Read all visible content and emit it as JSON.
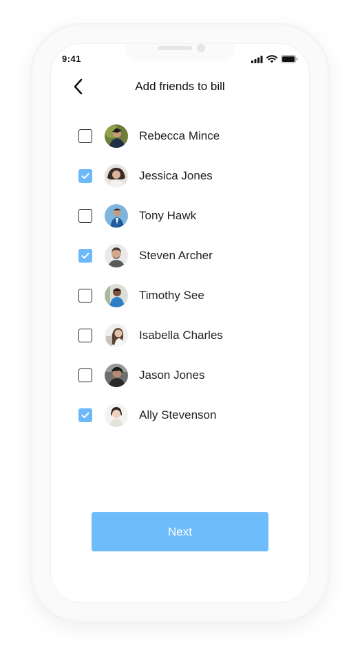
{
  "status_bar": {
    "time": "9:41",
    "icons": [
      "cellular-signal-icon",
      "wifi-icon",
      "battery-icon"
    ]
  },
  "header": {
    "title": "Add friends to bill",
    "back_icon": "chevron-left-icon"
  },
  "friends": [
    {
      "name": "Rebecca Mince",
      "checked": false
    },
    {
      "name": "Jessica Jones",
      "checked": true
    },
    {
      "name": "Tony Hawk",
      "checked": false
    },
    {
      "name": "Steven Archer",
      "checked": true
    },
    {
      "name": "Timothy See",
      "checked": false
    },
    {
      "name": "Isabella Charles",
      "checked": false
    },
    {
      "name": "Jason Jones",
      "checked": false
    },
    {
      "name": "Ally Stevenson",
      "checked": true
    }
  ],
  "next_button": {
    "label": "Next"
  },
  "colors": {
    "accent": "#6fbcfa",
    "text": "#222222",
    "background": "#ffffff"
  }
}
